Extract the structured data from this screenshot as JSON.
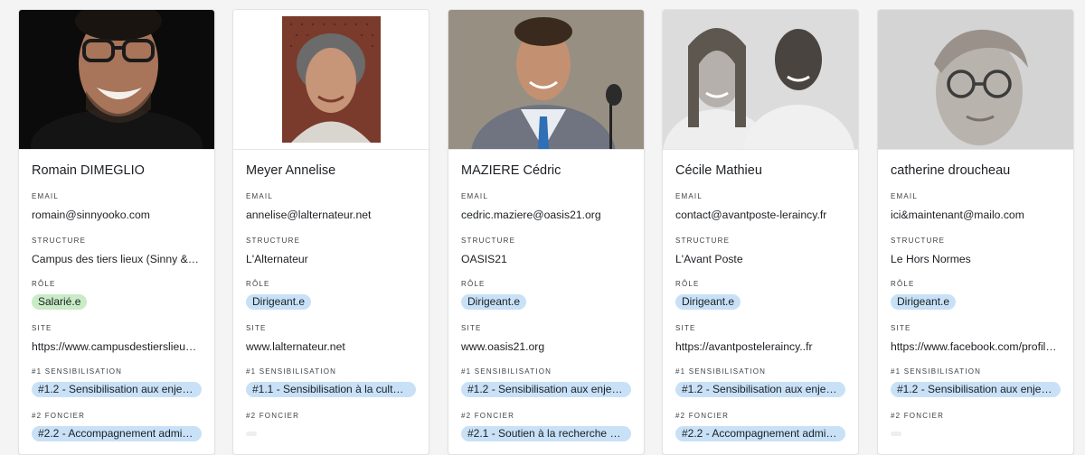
{
  "labels": {
    "email": "EMAIL",
    "structure": "STRUCTURE",
    "role": "RÔLE",
    "site": "SITE",
    "sensibilisation": "#1 SENSIBILISATION",
    "foncier": "#2 FONCIER"
  },
  "cards": [
    {
      "name": "Romain DIMEGLIO",
      "email": "romain@sinnyooko.com",
      "structure": "Campus des tiers lieux (Sinny & O…",
      "role": "Salarié.e",
      "role_color": "#c9ebc6",
      "site": "https://www.campusdestierslieux.…",
      "sensibilisation": "#1.2 -  Sensibilisation aux enjeu…",
      "foncier": "#2.2 - Accompagnement admin…"
    },
    {
      "name": "Meyer Annelise",
      "email": "annelise@lalternateur.net",
      "structure": "L'Alternateur",
      "role": "Dirigeant.e",
      "role_color": "#c8e1f7",
      "site": "www.lalternateur.net",
      "sensibilisation": "#1.1 - Sensibilisation à la cultur…",
      "foncier": ""
    },
    {
      "name": "MAZIERE Cédric",
      "email": "cedric.maziere@oasis21.org",
      "structure": "OASIS21",
      "role": "Dirigeant.e",
      "role_color": "#c8e1f7",
      "site": "www.oasis21.org",
      "sensibilisation": "#1.2 -  Sensibilisation aux enjeu…",
      "foncier": "#2.1 - Soutien à la recherche de…"
    },
    {
      "name": "Cécile Mathieu",
      "email": "contact@avantposte-leraincy.fr",
      "structure": "L'Avant Poste",
      "role": "Dirigeant.e",
      "role_color": "#c8e1f7",
      "site": "https://avantposteleraincy..fr",
      "sensibilisation": "#1.2 -  Sensibilisation aux enjeu…",
      "foncier": "#2.2 - Accompagnement admin…"
    },
    {
      "name": "catherine droucheau",
      "email": "ici&maintenant@mailo.com",
      "structure": "Le Hors Normes",
      "role": "Dirigeant.e",
      "role_color": "#c8e1f7",
      "site": "https://www.facebook.com/profile.…",
      "sensibilisation": "#1.2 -  Sensibilisation aux enjeu…",
      "foncier": ""
    }
  ]
}
